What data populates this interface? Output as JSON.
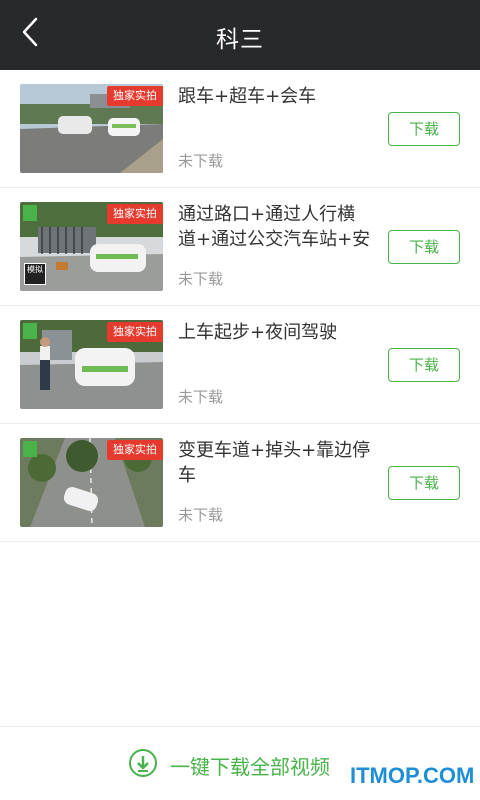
{
  "header": {
    "title": "科三"
  },
  "items": [
    {
      "tag": "独家实拍",
      "title": "跟车+超车+会车",
      "status": "未下载",
      "button": "下载"
    },
    {
      "tag": "独家实拍",
      "title": "通过路口+通过人行横道+通过公交汽车站+安",
      "status": "未下载",
      "button": "下载",
      "badge": "模拟"
    },
    {
      "tag": "独家实拍",
      "title": "上车起步+夜间驾驶",
      "status": "未下载",
      "button": "下载"
    },
    {
      "tag": "独家实拍",
      "title": "变更车道+掉头+靠边停车",
      "status": "未下载",
      "button": "下载"
    }
  ],
  "footer": {
    "download_all": "一键下载全部视频",
    "watermark": "ITMOP.COM"
  },
  "colors": {
    "accent": "#49b34a",
    "header_bg": "#28292d",
    "tag_red": "#e63a2f"
  }
}
